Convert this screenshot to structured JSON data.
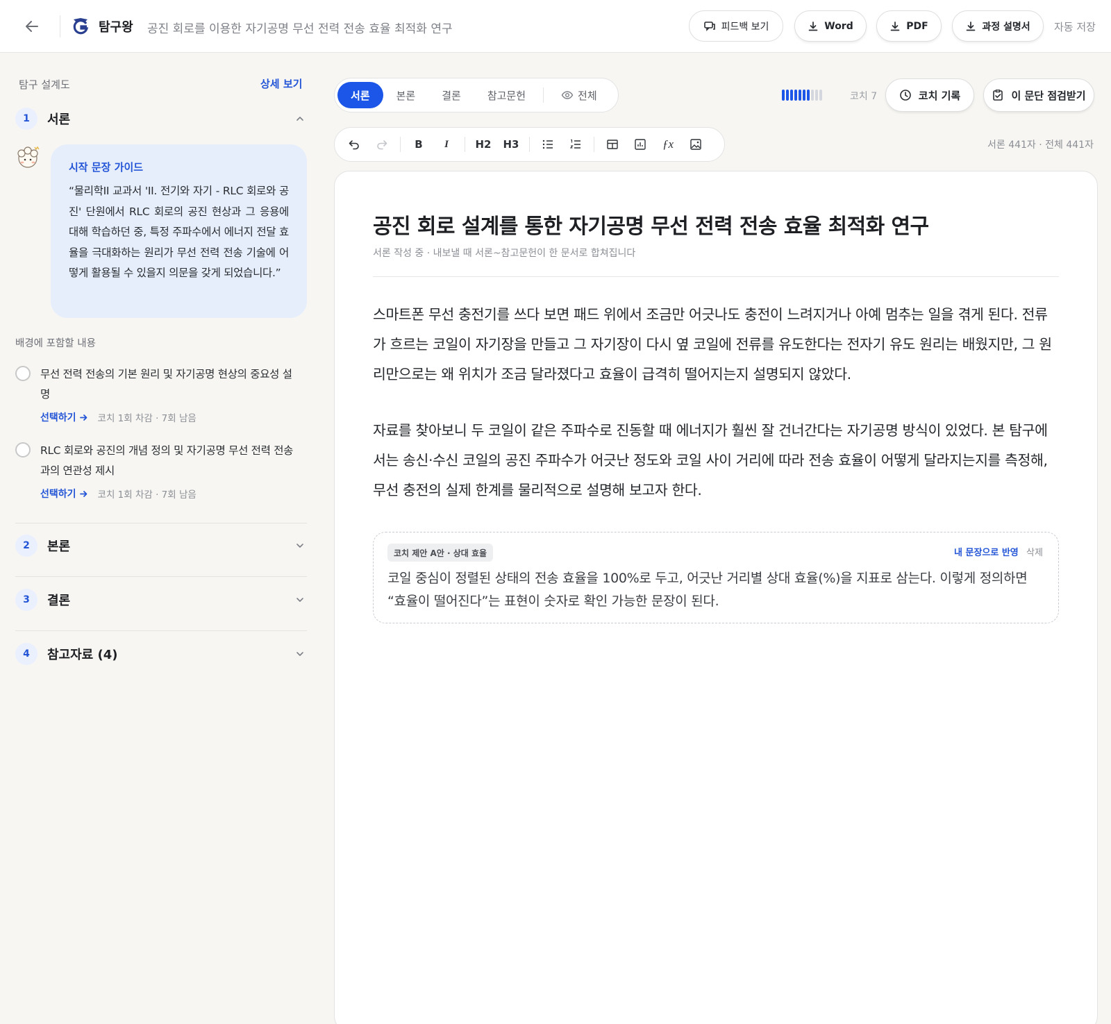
{
  "header": {
    "brand": "탐구왕",
    "doc_title": "공진 회로를 이용한 자기공명 무선 전력 전송 효율 최적화 연구",
    "feedback_label": "피드백 보기",
    "word_label": "Word",
    "pdf_label": "PDF",
    "process_label": "과정 설명서",
    "autosave": "자동 저장"
  },
  "sidebar": {
    "title": "탐구 설계도",
    "detail_link": "상세 보기",
    "sections": [
      {
        "num": "1",
        "label": "서론",
        "expanded": true
      },
      {
        "num": "2",
        "label": "본론",
        "expanded": false
      },
      {
        "num": "3",
        "label": "결론",
        "expanded": false
      },
      {
        "num": "4",
        "label": "참고자료 (4)",
        "expanded": false
      }
    ],
    "guide": {
      "title": "시작 문장 가이드",
      "body": "“물리학II 교과서 'II. 전기와 자기 - RLC 회로와 공진' 단원에서 RLC 회로의 공진 현상과 그 응용에 대해 학습하던 중, 특정 주파수에서 에너지 전달 효율을 극대화하는 원리가 무선 전력 전송 기술에 어떻게 활용될 수 있을지 의문을 갖게 되었습니다.”"
    },
    "background_label": "배경에 포함할 내용",
    "items": [
      {
        "text": "무선 전력 전송의 기본 원리 및 자기공명 현상의 중요성 설명",
        "select": "선택하기",
        "meta": "코치 1회 차감 · 7회 남음"
      },
      {
        "text": "RLC 회로와 공진의 개념 정의 및 자기공명 무선 전력 전송과의 연관성 제시",
        "select": "선택하기",
        "meta": "코치 1회 차감 · 7회 남음"
      }
    ]
  },
  "tabs": [
    {
      "label": "서론",
      "active": true
    },
    {
      "label": "본론",
      "active": false
    },
    {
      "label": "결론",
      "active": false
    },
    {
      "label": "참고문헌",
      "active": false
    },
    {
      "label": "전체",
      "active": false
    }
  ],
  "coach": {
    "remaining": 7,
    "total": 10,
    "count_label": "코치 7",
    "log_label": "코치 기록",
    "check_label": "이 문단 점검받기"
  },
  "toolbar": {
    "bold": "B",
    "italic": "I",
    "h2": "H2",
    "h3": "H3",
    "char_count": "서론 441자 · 전체 441자"
  },
  "editor": {
    "title": "공진 회로 설계를 통한 자기공명 무선 전력 전송 효율 최적화 연구",
    "subtitle": "서론 작성 중 · 내보낼 때 서론~참고문헌이 한 문서로 합쳐집니다",
    "paragraphs": [
      "스마트폰 무선 충전기를 쓰다 보면 패드 위에서 조금만 어긋나도 충전이 느려지거나 아예 멈추는 일을 겪게 된다. 전류가 흐르는 코일이 자기장을 만들고 그 자기장이 다시 옆 코일에 전류를 유도한다는 전자기 유도 원리는 배웠지만, 그 원리만으로는 왜 위치가 조금 달라졌다고 효율이 급격히 떨어지는지 설명되지 않았다.",
      "자료를 찾아보니 두 코일이 같은 주파수로 진동할 때 에너지가 훨씬 잘 건너간다는 자기공명 방식이 있었다. 본 탐구에서는 송신·수신 코일의 공진 주파수가 어긋난 정도와 코일 사이 거리에 따라 전송 효율이 어떻게 달라지는지를 측정해, 무선 충전의 실제 한계를 물리적으로 설명해 보고자 한다."
    ],
    "suggestion": {
      "badge": "코치 제안 A안 · 상대 효율",
      "apply": "내 문장으로 반영",
      "delete": "삭제",
      "text": "코일 중심이 정렬된 상태의 전송 효율을 100%로 두고, 어긋난 거리별 상대 효율(%)을 지표로 삼는다. 이렇게 정의하면 “효율이 떨어진다”는 표현이 숫자로 확인 가능한 문장이 된다."
    }
  },
  "colors": {
    "accent": "#1b56e8",
    "link": "#2355d6",
    "guide_bg": "#e6eefc",
    "page_bg": "#f7f6f3"
  }
}
